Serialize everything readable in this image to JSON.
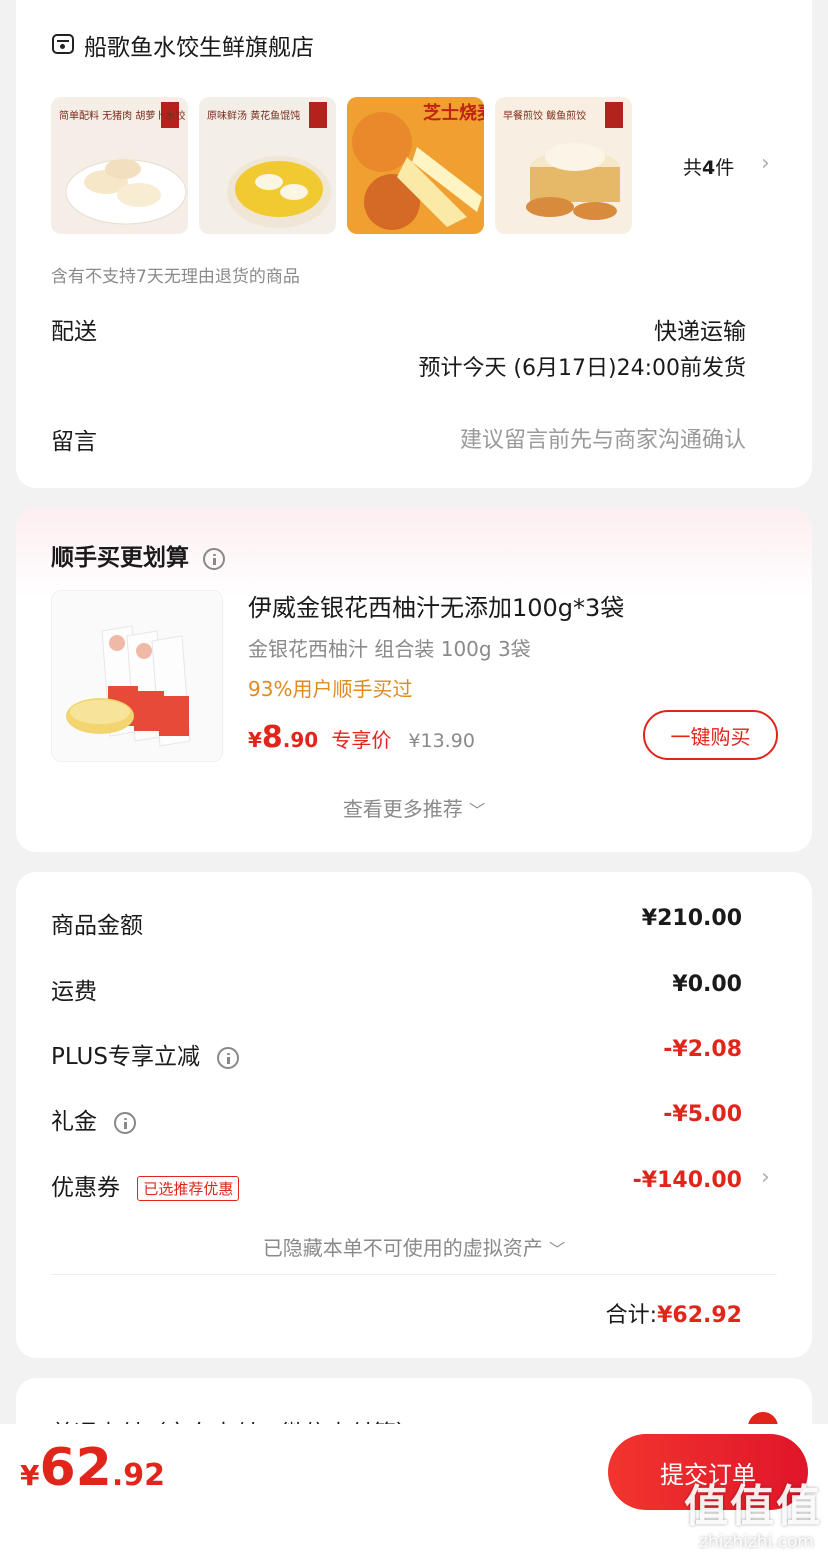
{
  "store": {
    "name": "船歌鱼水饺生鲜旗舰店",
    "item_count_prefix": "共",
    "item_count": "4",
    "item_count_suffix": "件",
    "thumbs": [
      {
        "text": "简单配料 无猪肉 胡萝卜水饺"
      },
      {
        "text": "原味鲜汤 黄花鱼馄饨"
      },
      {
        "text": "芝士烧麦"
      },
      {
        "text": "早餐煎饺 鲅鱼煎饺"
      }
    ],
    "return_notice": "含有不支持7天无理由退货的商品",
    "delivery_label": "配送",
    "delivery_method": "快递运输",
    "delivery_eta": "预计今天 (6月17日)24:00前发货",
    "message_label": "留言",
    "message_placeholder": "建议留言前先与商家沟通确认"
  },
  "recommend": {
    "title": "顺手买更划算",
    "product_name": "伊威金银花西柚汁无添加100g*3袋",
    "product_spec": "金银花西柚汁 组合装 100g 3袋",
    "social_proof": "93%用户顺手买过",
    "price_symbol": "¥",
    "price_int": "8",
    "price_dec": ".90",
    "price_tag": "专享价",
    "original_price": "¥13.90",
    "buy_button": "一键购买",
    "more_link": "查看更多推荐"
  },
  "summary": {
    "rows": [
      {
        "label": "商品金额",
        "value": "¥210.00"
      },
      {
        "label": "运费",
        "value": "¥0.00"
      },
      {
        "label": "PLUS专享立减",
        "value": "-¥2.08"
      },
      {
        "label": "礼金",
        "value": "-¥5.00"
      },
      {
        "label": "优惠券",
        "value": "-¥140.00",
        "tag": "已选推荐优惠"
      }
    ],
    "hidden_assets": "已隐藏本单不可使用的虚拟资产",
    "total_label": "合计:",
    "total_value": "¥62.92"
  },
  "payment": {
    "title_partial": "普通支付（京东支付、微信支付等）"
  },
  "bottom_bar": {
    "price_symbol": "¥",
    "price_int": "62",
    "price_dec": ".92",
    "submit": "提交订单"
  },
  "watermark": {
    "logo": "值值值",
    "site": "zhizhizhi.com"
  },
  "colors": {
    "accent": "#e1251b",
    "social_proof": "#e08a1e",
    "background": "#f2f2f2"
  }
}
